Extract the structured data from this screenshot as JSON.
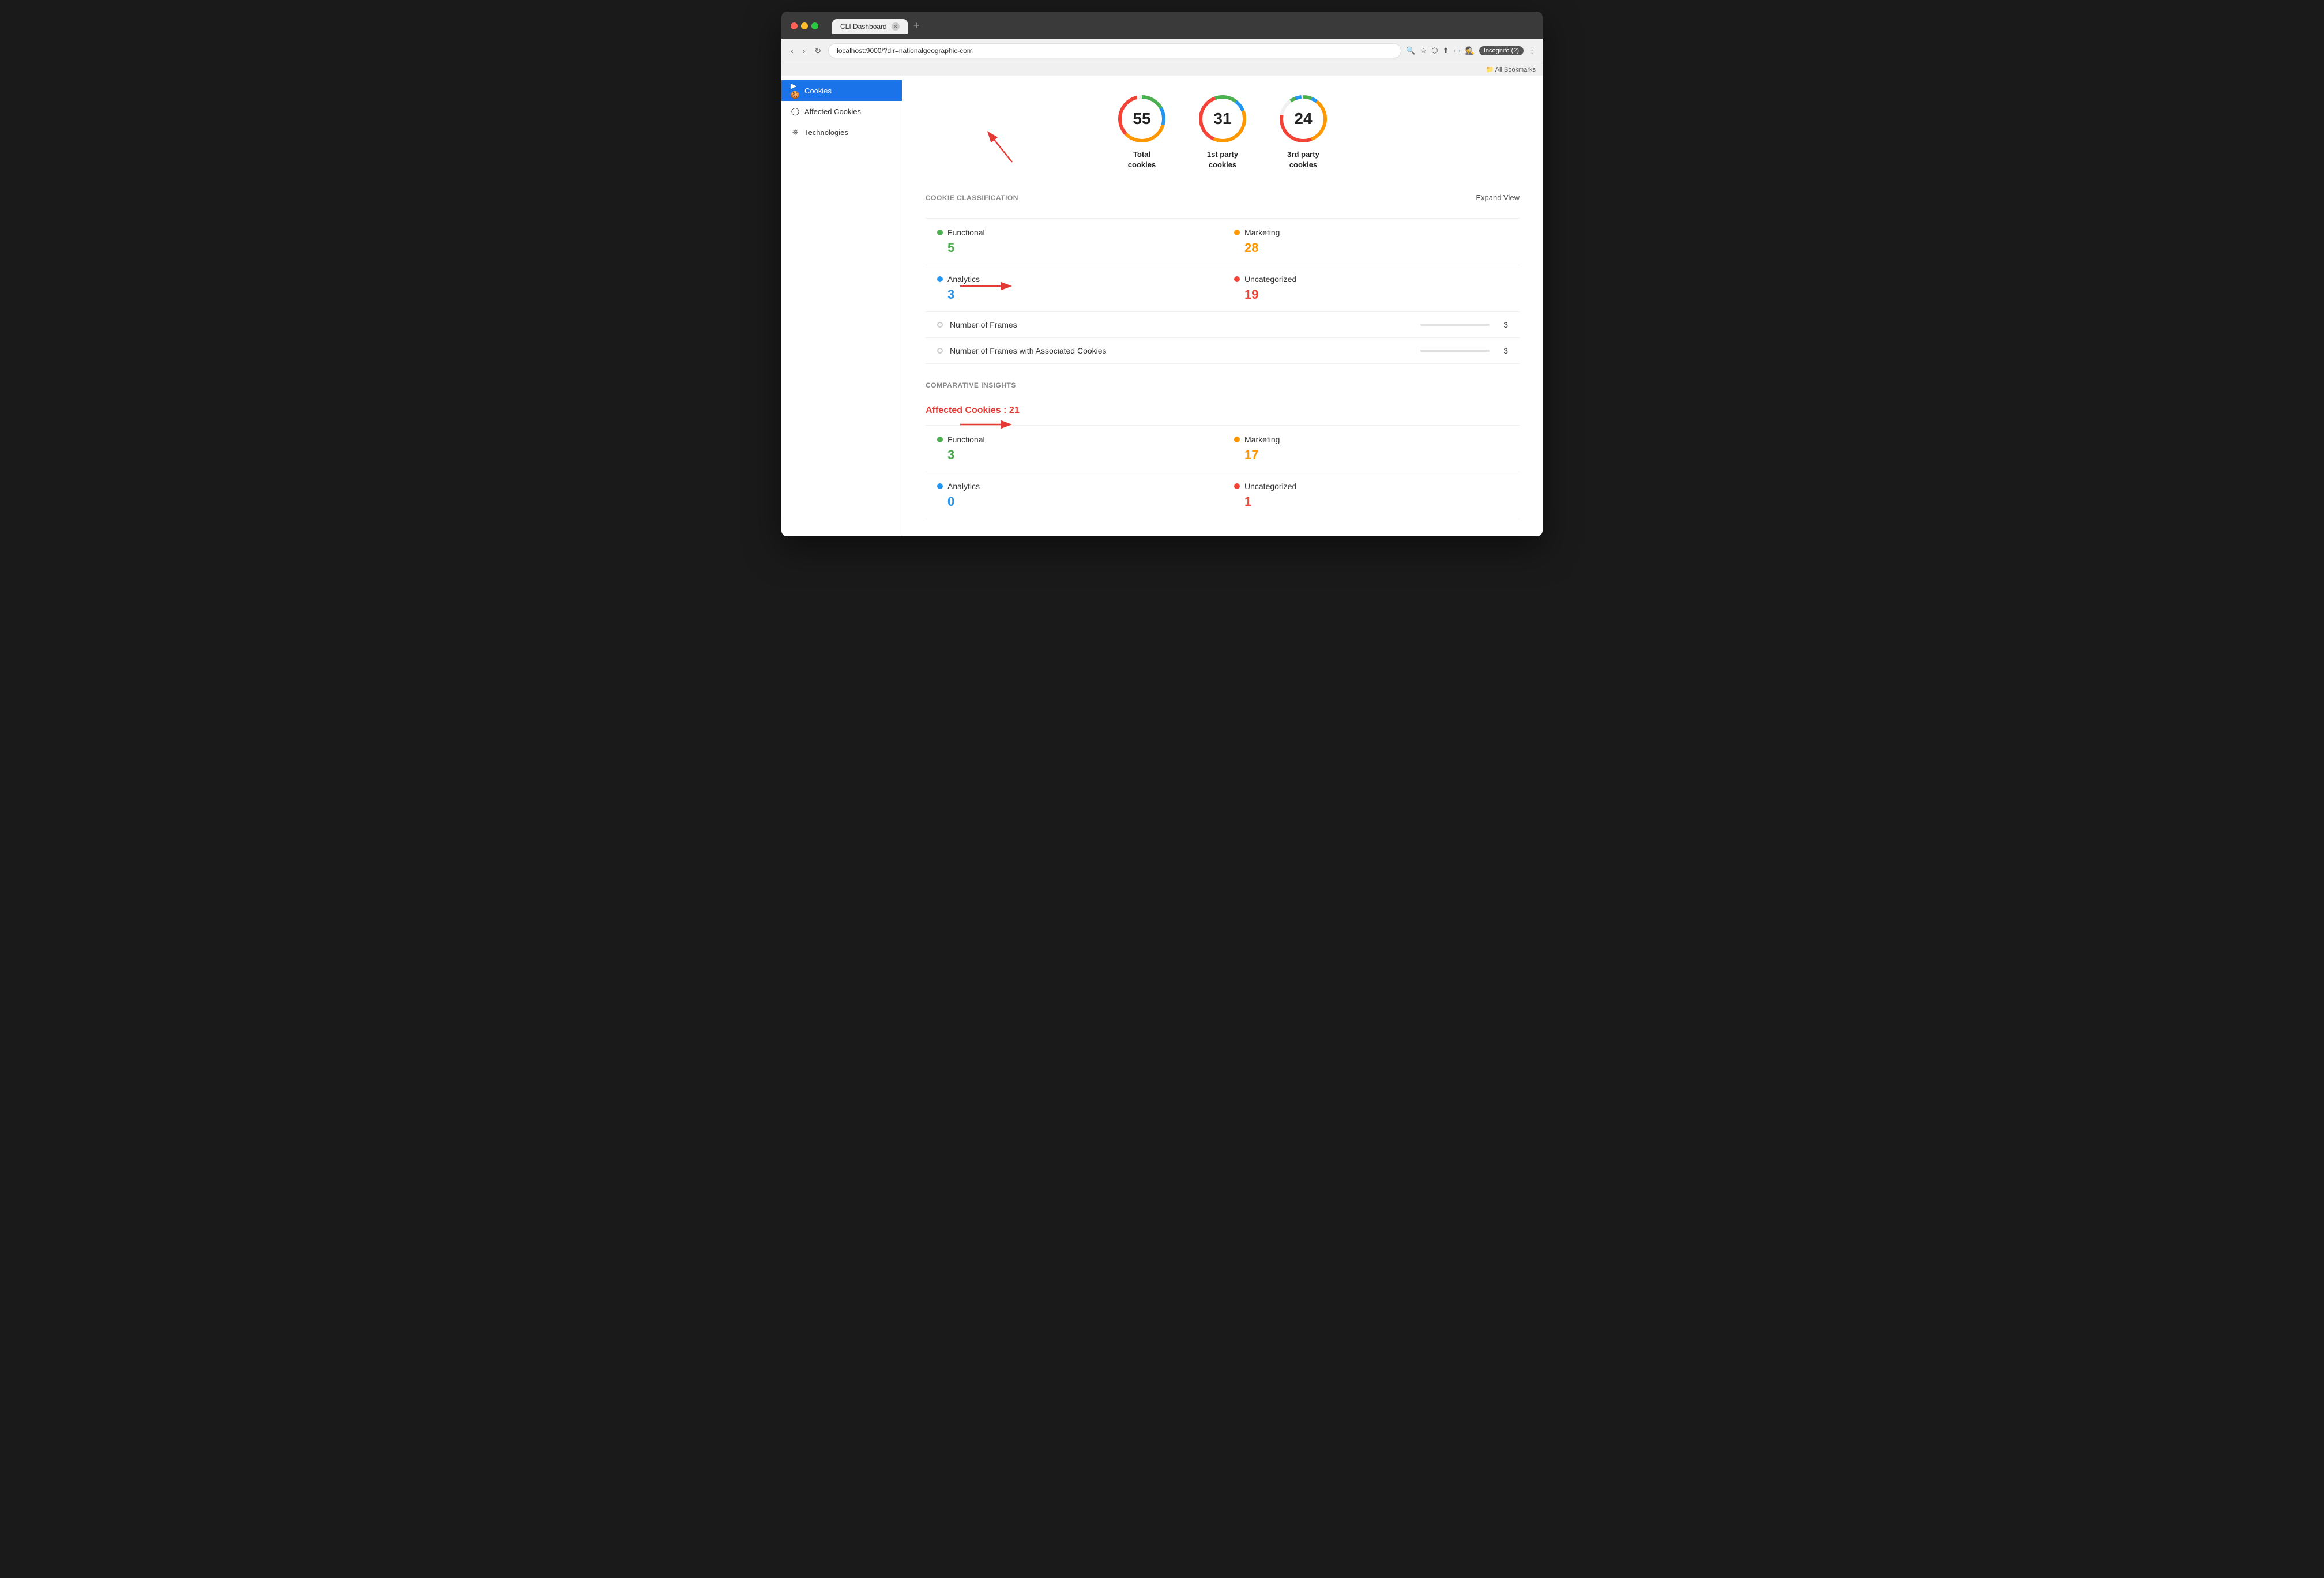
{
  "browser": {
    "tab_title": "CLI Dashboard",
    "url": "localhost:9000/?dir=nationalgeographic-com",
    "new_tab_btn": "+",
    "nav_back": "‹",
    "nav_forward": "›",
    "nav_refresh": "↻",
    "incognito_label": "Incognito (2)",
    "bookmarks_label": "All Bookmarks"
  },
  "sidebar": {
    "items": [
      {
        "id": "cookies",
        "label": "Cookies",
        "active": true
      },
      {
        "id": "affected-cookies",
        "label": "Affected Cookies",
        "active": false
      },
      {
        "id": "technologies",
        "label": "Technologies",
        "active": false
      }
    ]
  },
  "summary_circles": [
    {
      "id": "total",
      "value": "55",
      "label": "Total\ncookies",
      "color1": "#4caf50",
      "color2": "#2196f3",
      "color3": "#ff9800",
      "color4": "#f44336"
    },
    {
      "id": "first-party",
      "value": "31",
      "label": "1st party\ncookies",
      "color1": "#4caf50",
      "color2": "#2196f3",
      "color3": "#ff9800",
      "color4": "#f44336"
    },
    {
      "id": "third-party",
      "value": "24",
      "label": "3rd party\ncookies",
      "color1": "#4caf50",
      "color2": "#2196f3",
      "color3": "#ff9800",
      "color4": "#f44336"
    }
  ],
  "cookie_classification": {
    "section_title": "COOKIE CLASSIFICATION",
    "expand_btn": "Expand View",
    "items": [
      {
        "id": "functional",
        "label": "Functional",
        "value": "5",
        "dot_class": "dot-green",
        "value_class": "value-green",
        "col": 1
      },
      {
        "id": "marketing",
        "label": "Marketing",
        "value": "28",
        "dot_class": "dot-orange",
        "value_class": "value-orange",
        "col": 2
      },
      {
        "id": "analytics",
        "label": "Analytics",
        "value": "3",
        "dot_class": "dot-blue",
        "value_class": "value-blue",
        "col": 1
      },
      {
        "id": "uncategorized",
        "label": "Uncategorized",
        "value": "19",
        "dot_class": "dot-red",
        "value_class": "value-red",
        "col": 2
      }
    ],
    "frames": [
      {
        "id": "num-frames",
        "label": "Number of Frames",
        "value": "3"
      },
      {
        "id": "num-frames-cookies",
        "label": "Number of Frames with Associated Cookies",
        "value": "3"
      }
    ]
  },
  "comparative_insights": {
    "section_title": "COMPARATIVE INSIGHTS",
    "affected_cookies_label": "Affected Cookies : 21",
    "items": [
      {
        "id": "functional",
        "label": "Functional",
        "value": "3",
        "dot_class": "dot-green",
        "value_class": "value-green",
        "col": 1
      },
      {
        "id": "marketing",
        "label": "Marketing",
        "value": "17",
        "dot_class": "dot-orange",
        "value_class": "value-orange",
        "col": 2
      },
      {
        "id": "analytics",
        "label": "Analytics",
        "value": "0",
        "dot_class": "dot-blue",
        "value_class": "value-blue",
        "col": 1
      },
      {
        "id": "uncategorized",
        "label": "Uncategorized",
        "value": "1",
        "dot_class": "dot-red",
        "value_class": "value-red",
        "col": 2
      }
    ]
  }
}
